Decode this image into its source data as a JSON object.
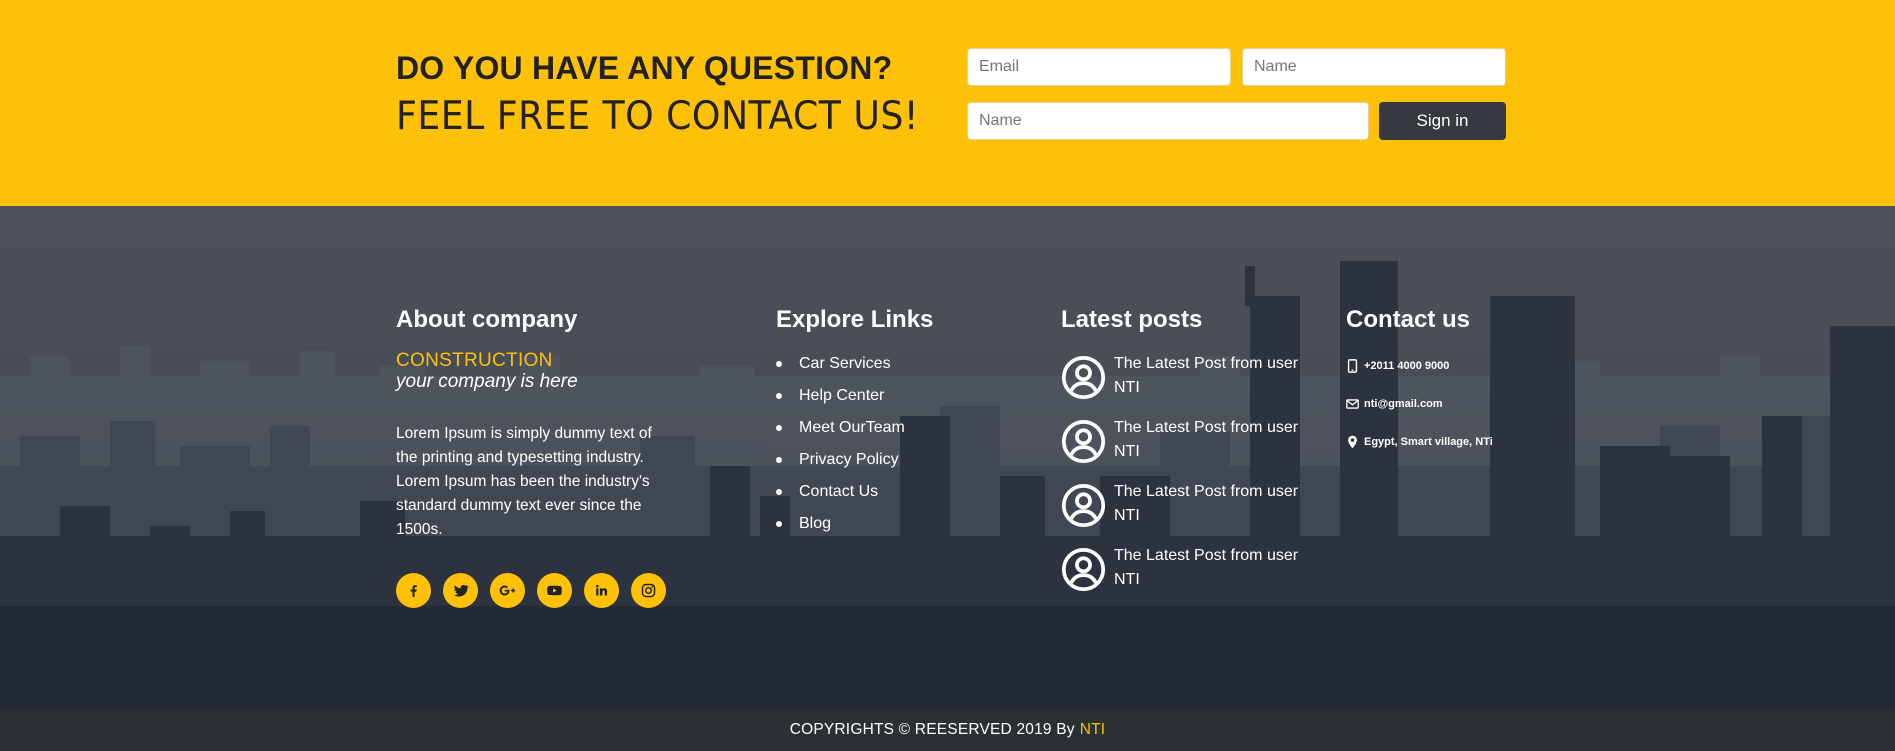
{
  "contact_band": {
    "title": "DO YOU HAVE ANY QUESTION?",
    "subtitle": "FEEL FREE TO CONTACT US!",
    "email_placeholder": "Email",
    "name_placeholder": "Name",
    "name2_placeholder": "Name",
    "submit_label": "Sign in"
  },
  "about": {
    "heading": "About company",
    "brand": "CONSTRUCTION",
    "tagline": "your company is here",
    "text": "Lorem Ipsum is simply dummy text of the printing and typesetting industry. Lorem Ipsum has been the industry's standard dummy text ever since the 1500s.",
    "socials": [
      "facebook-icon",
      "twitter-icon",
      "google-plus-icon",
      "youtube-icon",
      "linkedin-icon",
      "instagram-icon"
    ]
  },
  "explore": {
    "heading": "Explore Links",
    "items": [
      "Car Services",
      "Help Center",
      "Meet OurTeam",
      "Privacy Policy",
      "Contact Us",
      "Blog"
    ]
  },
  "posts": {
    "heading": "Latest posts",
    "items": [
      "The Latest Post from user NTI",
      "The Latest Post from user NTI",
      "The Latest Post from user NTI",
      "The Latest Post from user NTI"
    ]
  },
  "contact": {
    "heading": "Contact us",
    "phone": "+2011 4000 9000",
    "email": "nti@gmail.com",
    "address": "Egypt, Smart village, NTi"
  },
  "copyright": {
    "text": "COPYRIGHTS © REESERVED 2019 By",
    "brand": "NTI"
  },
  "colors": {
    "accent": "#ffc107",
    "dark": "#343a40",
    "footer_bottom": "#2b3033"
  }
}
